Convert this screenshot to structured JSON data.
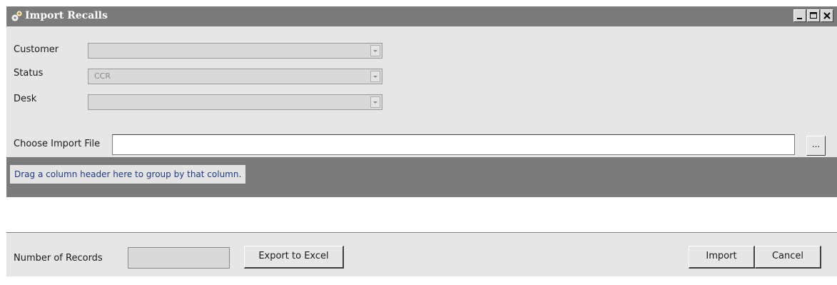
{
  "window": {
    "title": "Import Recalls",
    "icon": "gears-icon",
    "controls": {
      "minimize": "minimize-icon",
      "maximize": "maximize-icon",
      "close": "close-icon"
    }
  },
  "form": {
    "customer": {
      "label": "Customer",
      "value": ""
    },
    "status": {
      "label": "Status",
      "value": "CCR"
    },
    "desk": {
      "label": "Desk",
      "value": ""
    },
    "import_file": {
      "label": "Choose Import File",
      "value": "",
      "browse_label": "..."
    }
  },
  "grid": {
    "group_hint": "Drag a column header here to group by that column."
  },
  "footer": {
    "records_label": "Number of Records",
    "records_value": "",
    "export_label": "Export to Excel",
    "import_label": "Import",
    "cancel_label": "Cancel"
  },
  "colors": {
    "titlebar": "#7b7b7b",
    "window_bg": "#e6e6e6",
    "hint_text": "#1f3a8a"
  }
}
